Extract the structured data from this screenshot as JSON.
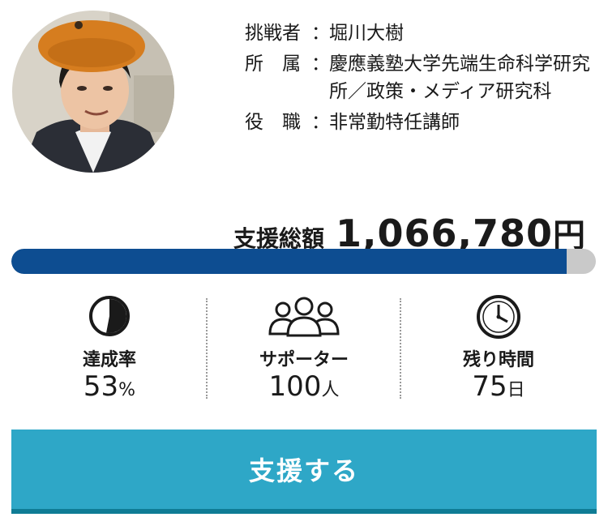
{
  "profile": {
    "avatar_alt": "挑戦者の写真",
    "rows": [
      {
        "label": "挑戦者",
        "colon": "：",
        "value": "堀川大樹"
      },
      {
        "label": "所　属",
        "colon": "：",
        "value": "慶應義塾大学先端生命科学研究所／政策・メディア研究科"
      },
      {
        "label": "役　職",
        "colon": "：",
        "value": "非常勤特任講師"
      }
    ]
  },
  "funding": {
    "total_label": "支援総額",
    "total_amount": "1,066,780",
    "total_unit": "円",
    "progress_fraction": 0.95
  },
  "stats": {
    "achievement": {
      "label": "達成率",
      "value": "53",
      "unit": "%",
      "icon": "pie-chart-icon",
      "fraction": 0.53
    },
    "supporters": {
      "label": "サポーター",
      "value": "100",
      "unit": "人",
      "icon": "people-icon"
    },
    "remaining": {
      "label": "残り時間",
      "value": "75",
      "unit": "日",
      "icon": "clock-icon"
    }
  },
  "cta": {
    "label": "支援する"
  },
  "colors": {
    "progress": "#0d4d91",
    "progress_bg": "#c9c9c9",
    "button": "#2ea7c7",
    "button_shadow": "#0f7c95"
  }
}
